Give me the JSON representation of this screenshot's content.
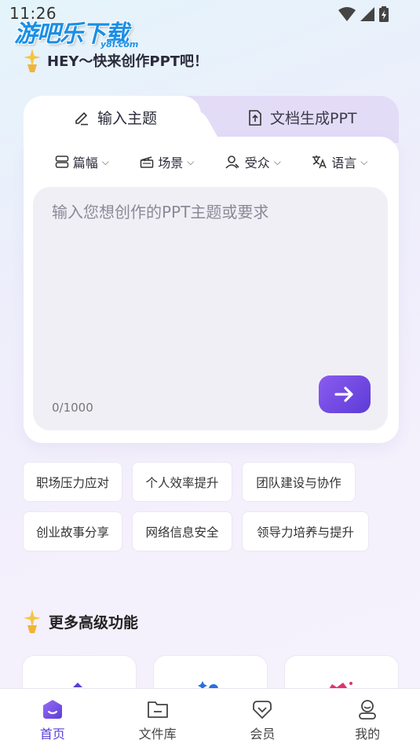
{
  "status_bar": {
    "time": "11:26"
  },
  "watermark": {
    "main": "游吧乐下载",
    "sub": "y8l.com"
  },
  "greeting": {
    "text": "HEY～快来创作PPT吧！"
  },
  "tabs": [
    {
      "label": "输入主题",
      "icon": "pen-icon",
      "active": true
    },
    {
      "label": "文档生成PPT",
      "icon": "upload-doc-icon",
      "active": false
    }
  ],
  "options": [
    {
      "label": "篇幅",
      "icon": "length-icon"
    },
    {
      "label": "场景",
      "icon": "scene-icon"
    },
    {
      "label": "受众",
      "icon": "audience-icon"
    },
    {
      "label": "语言",
      "icon": "language-icon"
    }
  ],
  "input": {
    "placeholder": "输入您想创作的PPT主题或要求",
    "counter": "0/1000"
  },
  "chips": [
    [
      "职场压力应对",
      "个人效率提升",
      "团队建设与协作"
    ],
    [
      "创业故事分享",
      "网络信息安全",
      "领导力培养与提升"
    ]
  ],
  "section": {
    "title": "更多高级功能"
  },
  "bottom_nav": [
    {
      "label": "首页",
      "icon": "home-icon",
      "active": true
    },
    {
      "label": "文件库",
      "icon": "folder-icon",
      "active": false
    },
    {
      "label": "会员",
      "icon": "vip-icon",
      "active": false
    },
    {
      "label": "我的",
      "icon": "profile-icon",
      "active": false
    }
  ],
  "colors": {
    "accent": "#5b3ed8",
    "tab_inactive_bg": "#e3dcf7",
    "input_bg": "#f1eff6"
  }
}
